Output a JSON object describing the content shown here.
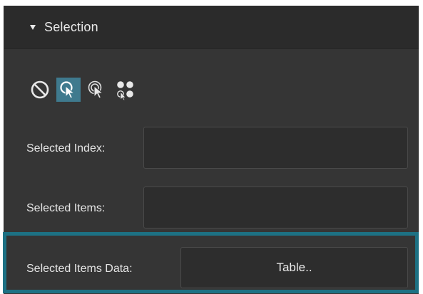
{
  "section": {
    "title": "Selection"
  },
  "toolbar": {
    "tools": [
      {
        "icon": "no-selection-icon",
        "active": false
      },
      {
        "icon": "single-select-cursor-icon",
        "active": true
      },
      {
        "icon": "multi-select-cursor-icon",
        "active": false
      },
      {
        "icon": "group-select-icon",
        "active": false
      }
    ]
  },
  "fields": {
    "selected_index_label": "Selected Index:",
    "selected_index_value": "",
    "selected_items_label": "Selected Items:",
    "selected_items_value": "",
    "selected_items_data_label": "Selected Items Data:",
    "selected_items_data_button": "Table.."
  },
  "colors": {
    "active_tool": "#3f7a8e",
    "highlight_border": "#1d7184"
  }
}
